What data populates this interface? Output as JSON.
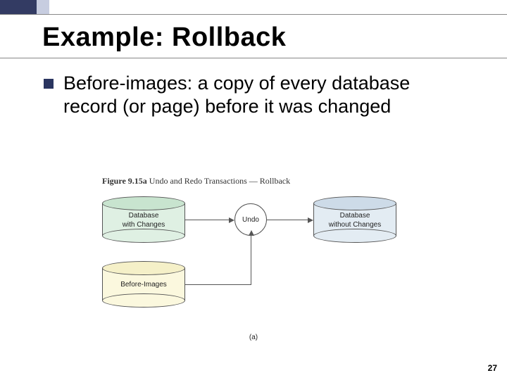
{
  "accent": {
    "primary": "#333b63",
    "secondary": "#c7cde0"
  },
  "title": "Example: Rollback",
  "bullet": {
    "text": "Before-images: a copy of every database record (or page) before it was changed"
  },
  "figure": {
    "caption_strong": "Figure 9.15a",
    "caption_rest": " Undo and Redo Transactions — Rollback",
    "db_with_changes": "Database\nwith Changes",
    "before_images": "Before-Images",
    "undo": "Undo",
    "db_without_changes": "Database\nwithout Changes",
    "sub": "(a)"
  },
  "page_number": "27"
}
